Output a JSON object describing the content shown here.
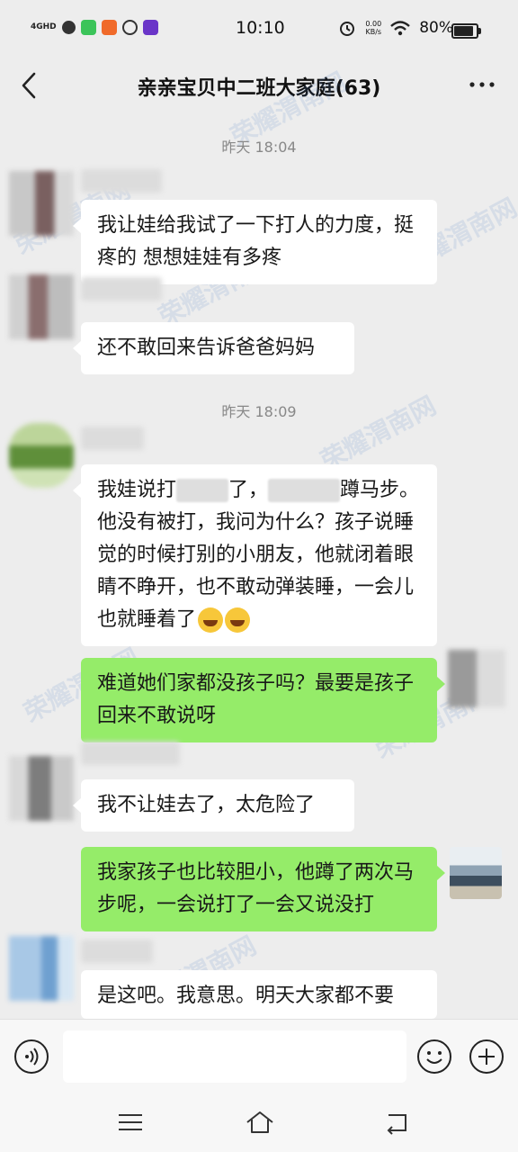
{
  "status_bar": {
    "network": "4GHD",
    "time": "10:10",
    "speed_value": "0.00",
    "speed_unit": "KB/s",
    "battery": "80%"
  },
  "header": {
    "title": "亲亲宝贝中二班大家庭(63)"
  },
  "chat": {
    "timestamps": [
      "昨天 18:04",
      "昨天 18:09"
    ],
    "messages": [
      {
        "side": "left",
        "text": "我让娃给我试了一下打人的力度，挺疼的 想想娃娃有多疼"
      },
      {
        "side": "left",
        "text": "还不敢回来告诉爸爸妈妈"
      },
      {
        "side": "left",
        "text_a": "我娃说打",
        "text_b": "了，",
        "text_c": "蹲马步。他没有被打，我问为什么？孩子说睡觉的时候打别的小朋友，他就闭着眼睛不睁开，也不敢动弹装睡，一会儿也就睡着了"
      },
      {
        "side": "right",
        "text": "难道她们家都没孩子吗？最要是孩子回来不敢说呀"
      },
      {
        "side": "left",
        "text": "我不让娃去了，太危险了"
      },
      {
        "side": "right",
        "text": "我家孩子也比较胆小，他蹲了两次马步呢，一会说打了一会又说没打"
      },
      {
        "side": "left",
        "text": "是这吧。我意思。明天大家都不要"
      }
    ]
  },
  "watermark": "荣耀渭南网",
  "colors": {
    "background": "#ededed",
    "bubble_left": "#ffffff",
    "bubble_right": "#95ec69"
  },
  "icons": [
    "back-icon",
    "more-icon",
    "voice-icon",
    "emoji-icon",
    "plus-icon",
    "menu-icon",
    "home-icon",
    "return-icon"
  ]
}
